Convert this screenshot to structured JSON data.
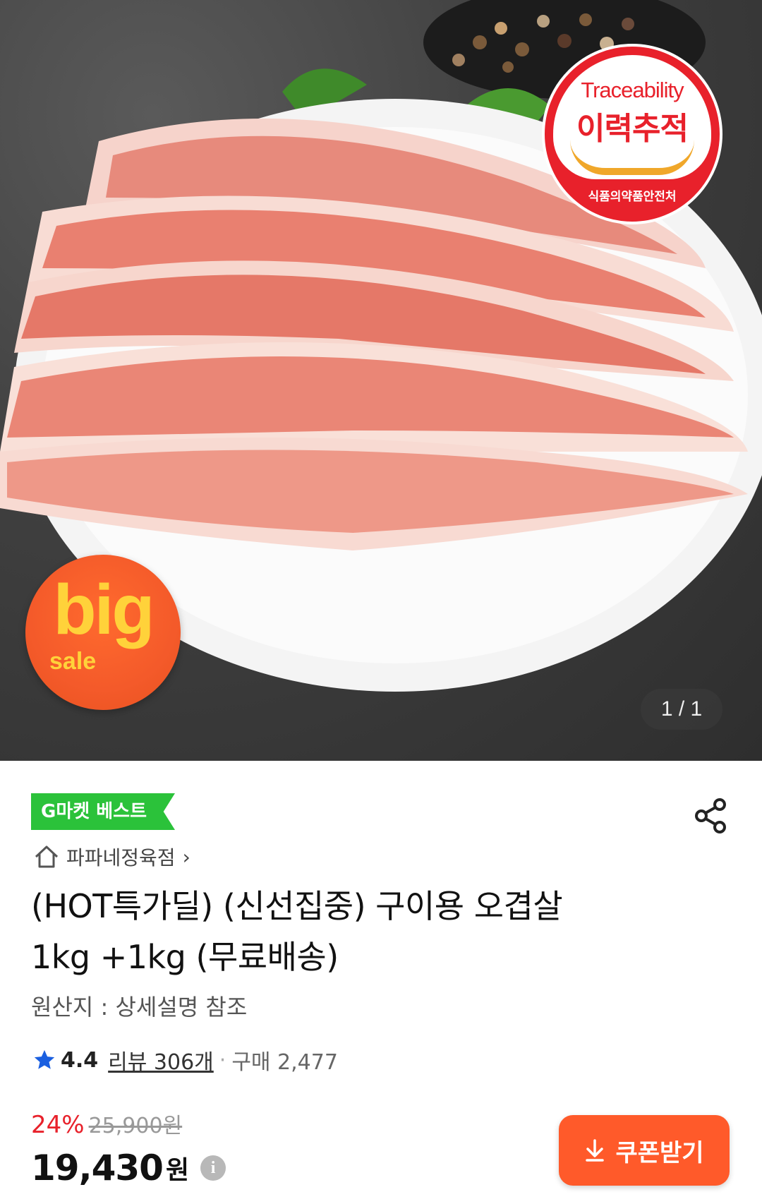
{
  "image": {
    "trace_badge": {
      "english": "Traceability",
      "korean": "이력추적",
      "agency": "식품의약품안전처"
    },
    "sale_badge": {
      "big": "big",
      "sale": "sale"
    },
    "counter": "1 / 1"
  },
  "product": {
    "best_badge": "G마켓 베스트",
    "store_name": "파파네정육점",
    "store_chevron": "›",
    "title_line1": "(HOT특가딜) (신선집중) 구이용 오겹살",
    "title_line2": "1kg +1kg (무료배송)",
    "origin": "원산지 : 상세설명 참조",
    "rating": "4.4",
    "review_label": "리뷰 306개",
    "separator": "·",
    "purchase_count": "구매 2,477",
    "discount_rate": "24%",
    "original_price": "25,900원",
    "price": "19,430",
    "price_unit": "원",
    "info_icon": "i",
    "coupon_button": "쿠폰받기"
  },
  "colors": {
    "accent_orange": "#ff5a2a",
    "discount_red": "#e8212b",
    "best_green": "#2bc23a",
    "star_blue": "#1a5fe0"
  },
  "icons": {
    "share": "share-icon",
    "store": "home-icon",
    "star": "star-icon",
    "download": "download-icon",
    "info": "info-icon"
  }
}
